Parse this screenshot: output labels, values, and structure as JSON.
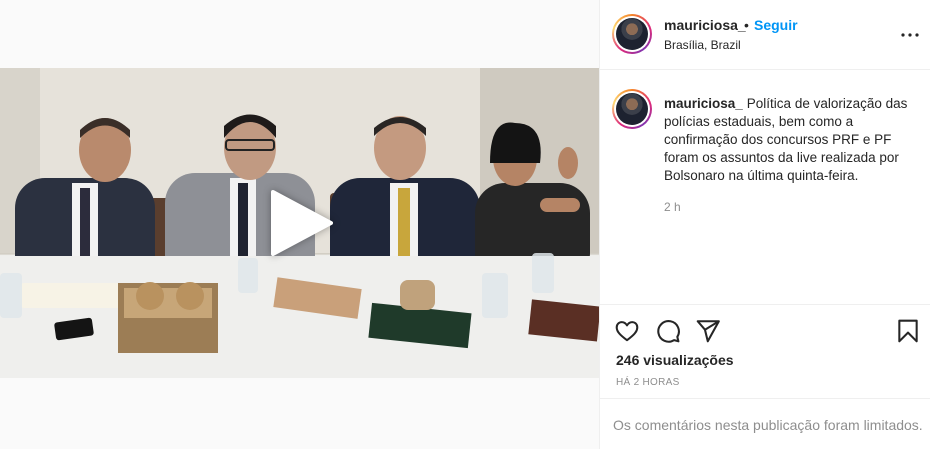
{
  "post": {
    "username": "mauriciosa_",
    "dot": "•",
    "follow_label": "Seguir",
    "location": "Brasília, Brazil",
    "caption": "Política de valorização das polícias estaduais, bem como a confirmação dos concursos PRF e PF foram os assuntos da live realizada por Bolsonaro na última quinta-feira.",
    "caption_time": "2 h",
    "views": "246 visualizações",
    "time_ago": "HÁ 2 HORAS",
    "comments_notice": "Os comentários nesta publicação foram limitados."
  },
  "icons": {
    "more": "more-options-icon",
    "like": "heart-icon",
    "comment": "comment-icon",
    "share": "paper-plane-icon",
    "save": "bookmark-icon",
    "play": "play-icon"
  },
  "colors": {
    "accent": "#0095f6",
    "muted": "#8e8e8e",
    "text": "#262626",
    "divider": "#efefef"
  }
}
